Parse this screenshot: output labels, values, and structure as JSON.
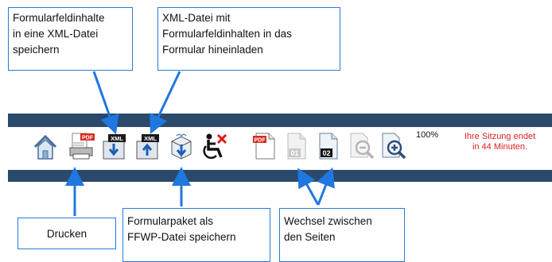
{
  "callouts": {
    "save_xml": [
      "Formularfeldinhalte",
      "in eine XML-Datei",
      "speichern"
    ],
    "load_xml": [
      "XML-Datei mit",
      "Formularfeldinhalten in das",
      "Formular hineinladen"
    ],
    "print": [
      "Drucken"
    ],
    "save_package": [
      "Formularpaket als",
      "FFWP-Datei speichern"
    ],
    "page_switch": [
      "Wechsel zwischen",
      "den Seiten"
    ]
  },
  "toolbar": {
    "icons": [
      "home-icon",
      "print-pdf-icon",
      "save-xml-icon",
      "load-xml-icon",
      "save-package-icon",
      "accessibility-exit-icon",
      "pdf-document-icon",
      "page-01-icon",
      "page-02-icon",
      "zoom-out-icon",
      "zoom-in-icon"
    ],
    "pdf_badge": "PDF",
    "xml_badge": "XML",
    "page_1": "01",
    "page_2": "02",
    "zoom_level": "100%",
    "session_line1": "Ihre Sitzung endet",
    "session_line2": "in 44 Minuten."
  },
  "colors": {
    "bar": "#2b4a6b",
    "callout_border": "#2a7ad6",
    "arrow": "#1f77e0",
    "session_text": "#e02020"
  }
}
